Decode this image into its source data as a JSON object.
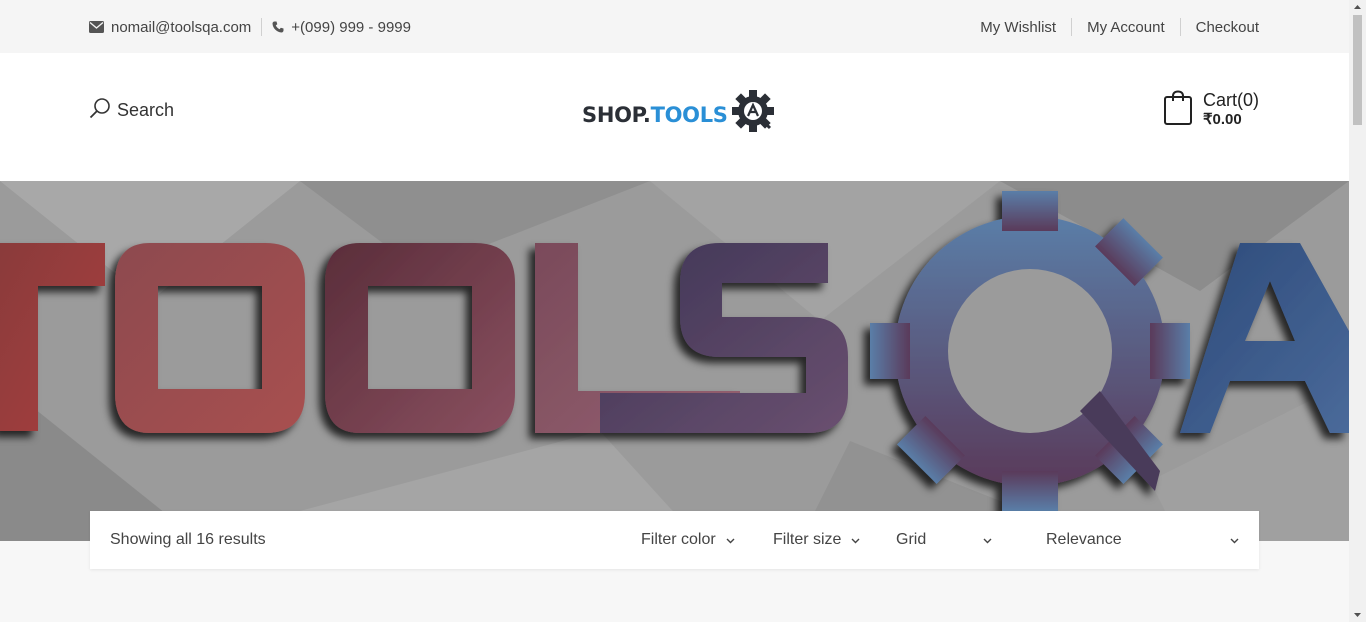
{
  "topbar": {
    "email": "nomail@toolsqa.com",
    "phone": "+(099) 999 - 9999",
    "links": [
      "My Wishlist",
      "My Account",
      "Checkout"
    ]
  },
  "header": {
    "search_label": "Search",
    "logo": {
      "part1": "SHOP.",
      "part2": "TOOLS"
    },
    "cart_label": "Cart(0)",
    "cart_amount": "₹0.00"
  },
  "banner": {
    "text": "TOOLSQA"
  },
  "toolbar": {
    "result_count": "Showing all 16 results",
    "filter_color": "Filter color",
    "filter_size": "Filter size",
    "view": "Grid",
    "sort": "Relevance"
  },
  "colors": {
    "accent_blue": "#2a8fd6",
    "logo_dark": "#2b2f36",
    "topbar_bg": "#f5f5f5"
  }
}
